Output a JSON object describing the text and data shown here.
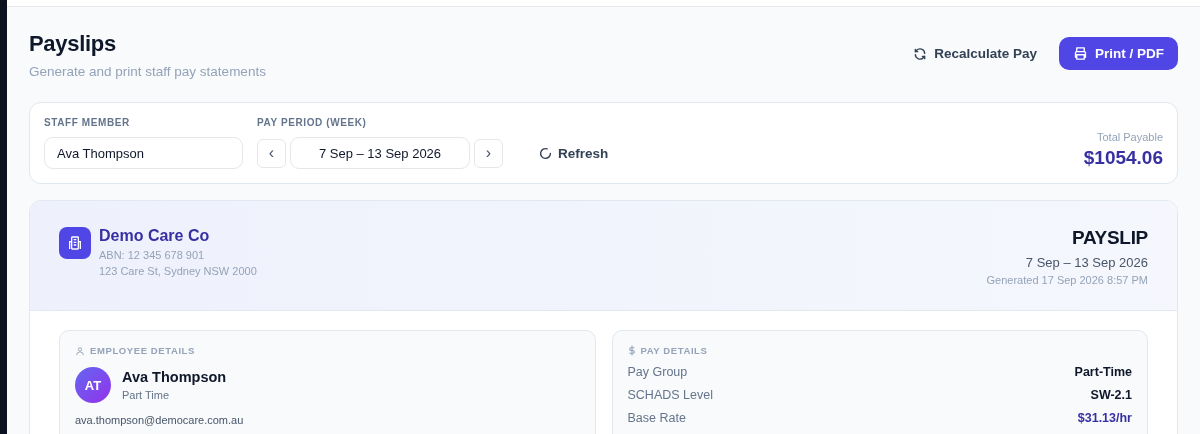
{
  "header": {
    "title": "Payslips",
    "subtitle": "Generate and print staff pay statements",
    "actions": [
      {
        "label": "Recalculate Pay",
        "kind": "ghost"
      },
      {
        "label": "Print / PDF",
        "kind": "primary"
      }
    ]
  },
  "filters": {
    "staff_label": "STAFF MEMBER",
    "staff_value": "Ava Thompson",
    "period_label": "PAY PERIOD (WEEK)",
    "prev": "‹",
    "period_value": "7 Sep – 13 Sep 2026",
    "next": "›",
    "refresh": "Refresh",
    "total_label": "Total Payable",
    "total_value": "$1054.06"
  },
  "payslip": {
    "company": "Demo Care Co",
    "abn": "ABN: 12 345 678 901",
    "address": "123 Care St, Sydney NSW 2000",
    "doc_title": "PAYSLIP",
    "period": "7 Sep – 13 Sep 2026",
    "generated": "Generated 17 Sep 2026 8:57 PM",
    "employee": {
      "heading": "EMPLOYEE DETAILS",
      "initials": "AT",
      "name": "Ava Thompson",
      "type": "Part Time",
      "email": "ava.thompson@democare.com.au"
    },
    "pay": {
      "heading": "PAY DETAILS",
      "rows": [
        {
          "label": "Pay Group",
          "value": "Part-Time",
          "kind": "plain"
        },
        {
          "label": "SCHADS Level",
          "value": "SW-2.1",
          "kind": "plain"
        },
        {
          "label": "Base Rate",
          "value": "$31.13/hr",
          "kind": "accent"
        }
      ]
    }
  }
}
